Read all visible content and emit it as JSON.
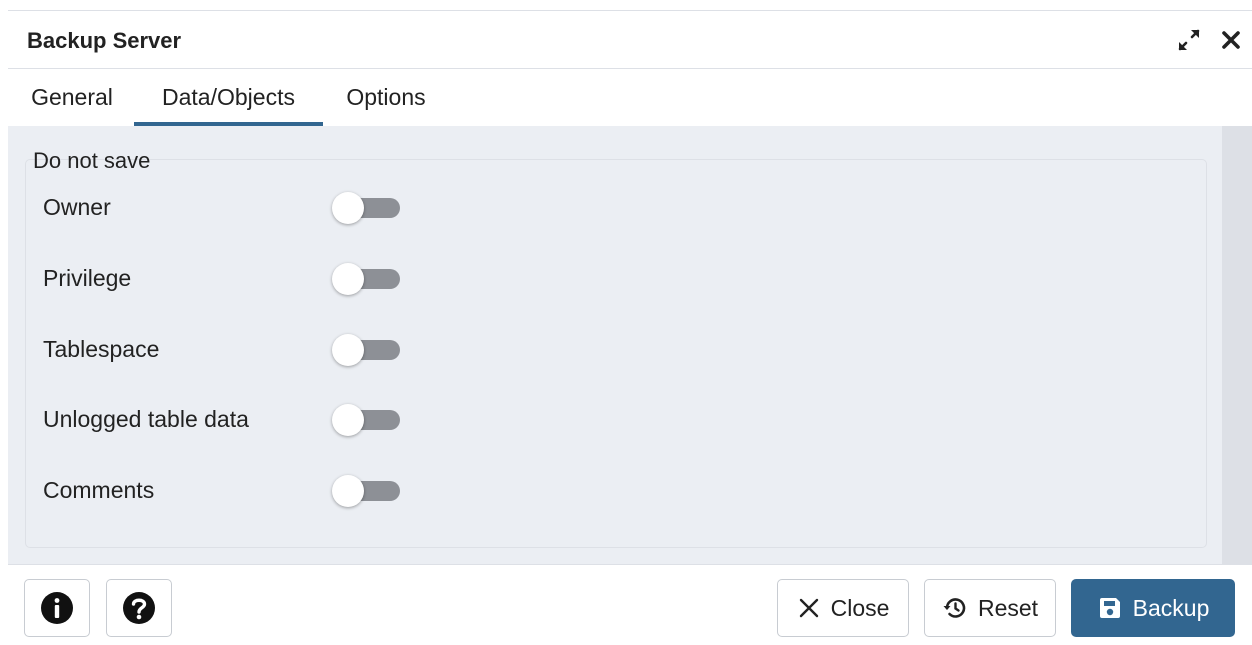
{
  "dialog": {
    "title": "Backup Server",
    "maximize_icon": "expand-arrows-icon",
    "close_icon": "close-icon"
  },
  "tabs": [
    {
      "label": "General",
      "active": false
    },
    {
      "label": "Data/Objects",
      "active": true
    },
    {
      "label": "Options",
      "active": false
    }
  ],
  "section": {
    "legend": "Do not save",
    "items": [
      {
        "label": "Owner",
        "enabled": false
      },
      {
        "label": "Privilege",
        "enabled": false
      },
      {
        "label": "Tablespace",
        "enabled": false
      },
      {
        "label": "Unlogged table data",
        "enabled": false
      },
      {
        "label": "Comments",
        "enabled": false
      }
    ]
  },
  "footer": {
    "info_icon": "info-icon",
    "help_icon": "help-icon",
    "close_label": "Close",
    "reset_label": "Reset",
    "backup_label": "Backup"
  },
  "colors": {
    "accent": "#326690",
    "panel_bg": "#ebeef3",
    "toggle_off_track": "#8d9096"
  }
}
